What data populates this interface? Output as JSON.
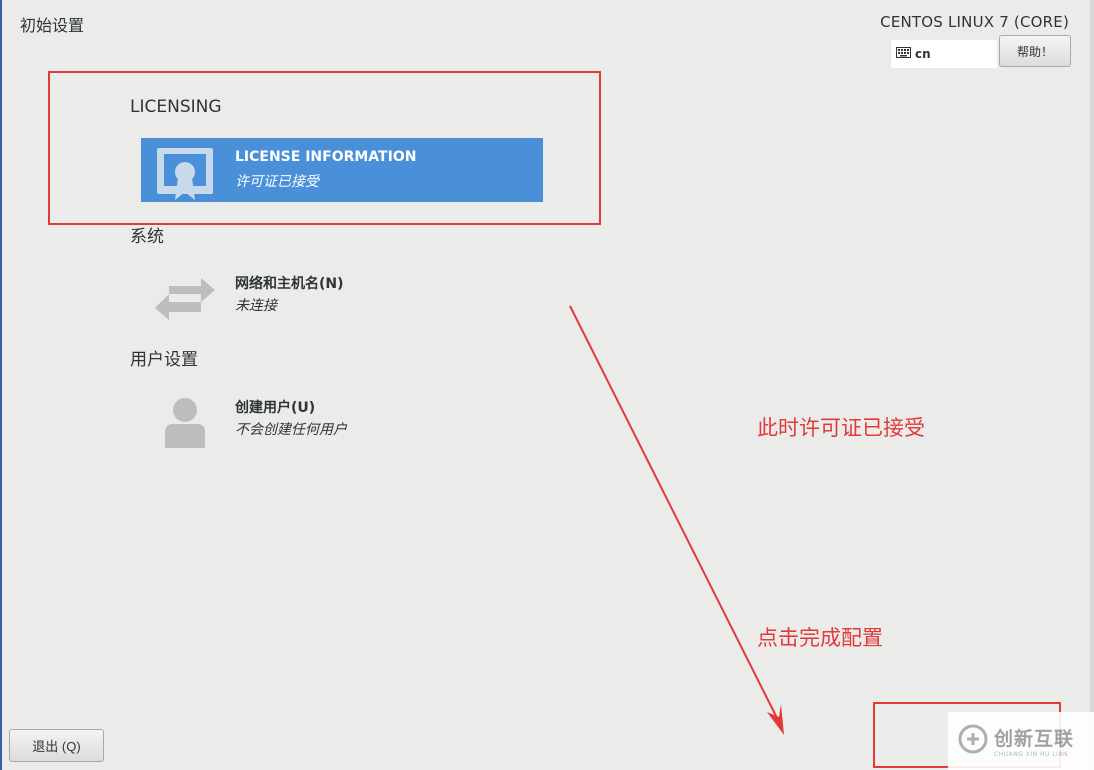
{
  "header": {
    "page_title": "初始设置",
    "product_title": "CENTOS LINUX 7 (CORE)",
    "keyboard_layout": "cn",
    "help_label": "帮助！"
  },
  "sections": [
    {
      "heading": "LICENSING",
      "spokes": [
        {
          "title": "LICENSE INFORMATION",
          "status": "许可证已接受",
          "icon": "certificate-icon",
          "selected": true
        }
      ]
    },
    {
      "heading": "系统",
      "spokes": [
        {
          "title": "网络和主机名(N)",
          "status": "未连接",
          "icon": "network-arrows-icon",
          "selected": false
        }
      ]
    },
    {
      "heading": "用户设置",
      "spokes": [
        {
          "title": "创建用户(U)",
          "status": "不会创建任何用户",
          "icon": "user-icon",
          "selected": false
        }
      ]
    }
  ],
  "footer": {
    "quit_label": "退出 (Q)"
  },
  "annotations": {
    "note_license": "此时许可证已接受",
    "note_finish": "点击完成配置",
    "color": "#e03b3b"
  },
  "watermark": {
    "text": "创新互联",
    "subtext": "CHUANG XIN HU LIAN"
  },
  "colors": {
    "selected_spoke": "#4a90d9",
    "background": "#ebebea"
  }
}
